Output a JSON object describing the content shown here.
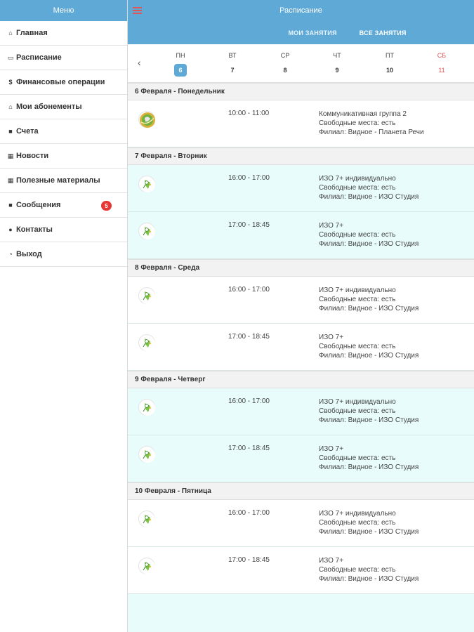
{
  "sidebar": {
    "title": "Меню",
    "items": [
      {
        "icon": "home-icon",
        "glyph": "⌂",
        "label": "Главная"
      },
      {
        "icon": "calendar-icon",
        "glyph": "▭",
        "label": "Расписание"
      },
      {
        "icon": "dollar-icon",
        "glyph": "$",
        "label": "Финансовые операции"
      },
      {
        "icon": "ticket-icon",
        "glyph": "⌂",
        "label": "Мои абонементы"
      },
      {
        "icon": "invoice-icon",
        "glyph": "■",
        "label": "Счета"
      },
      {
        "icon": "news-icon",
        "glyph": "▦",
        "label": "Новости"
      },
      {
        "icon": "materials-icon",
        "glyph": "▦",
        "label": "Полезные материалы"
      },
      {
        "icon": "messages-icon",
        "glyph": "■",
        "label": "Сообщения",
        "badge": "5"
      },
      {
        "icon": "location-icon",
        "glyph": "●",
        "label": "Контакты"
      },
      {
        "icon": "logout-icon",
        "glyph": "◔",
        "label": "Выход"
      }
    ]
  },
  "topbar": {
    "title": "Расписание"
  },
  "tabs": [
    {
      "label": "МОИ ЗАНЯТИЯ",
      "active": false
    },
    {
      "label": "ВСЕ ЗАНЯТИЯ",
      "active": true
    }
  ],
  "week": [
    {
      "name": "ПН",
      "num": "6",
      "selected": true
    },
    {
      "name": "ВТ",
      "num": "7"
    },
    {
      "name": "СР",
      "num": "8"
    },
    {
      "name": "ЧТ",
      "num": "9"
    },
    {
      "name": "ПТ",
      "num": "10"
    },
    {
      "name": "СБ",
      "num": "11",
      "weekend": true
    }
  ],
  "days": [
    {
      "header": "6 Февраля - Понедельник",
      "lessons": [
        {
          "time": "10:00 - 11:00",
          "title": "Коммуникативная группа 2",
          "places": "Свободные места: есть",
          "branch": "Филиал: Видное - Планета Речи",
          "bg": "white",
          "icon": "planet-logo-icon"
        }
      ]
    },
    {
      "header": "7 Февраля - Вторник",
      "lessons": [
        {
          "time": "16:00 - 17:00",
          "title": "ИЗО 7+ индивидуально",
          "places": "Свободные места: есть",
          "branch": "Филиал: Видное - ИЗО Студия",
          "bg": "cyan",
          "icon": "art-studio-logo-icon"
        },
        {
          "time": "17:00 - 18:45",
          "title": "ИЗО 7+",
          "places": "Свободные места: есть",
          "branch": "Филиал: Видное - ИЗО Студия",
          "bg": "cyan",
          "icon": "art-studio-logo-icon"
        }
      ]
    },
    {
      "header": "8 Февраля - Среда",
      "lessons": [
        {
          "time": "16:00 - 17:00",
          "title": "ИЗО 7+ индивидуально",
          "places": "Свободные места: есть",
          "branch": "Филиал: Видное - ИЗО Студия",
          "bg": "white",
          "icon": "art-studio-logo-icon"
        },
        {
          "time": "17:00 - 18:45",
          "title": "ИЗО 7+",
          "places": "Свободные места: есть",
          "branch": "Филиал: Видное - ИЗО Студия",
          "bg": "white",
          "icon": "art-studio-logo-icon"
        }
      ]
    },
    {
      "header": "9 Февраля - Четверг",
      "lessons": [
        {
          "time": "16:00 - 17:00",
          "title": "ИЗО 7+ индивидуально",
          "places": "Свободные места: есть",
          "branch": "Филиал: Видное - ИЗО Студия",
          "bg": "cyan",
          "icon": "art-studio-logo-icon"
        },
        {
          "time": "17:00 - 18:45",
          "title": "ИЗО 7+",
          "places": "Свободные места: есть",
          "branch": "Филиал: Видное - ИЗО Студия",
          "bg": "cyan",
          "icon": "art-studio-logo-icon"
        }
      ]
    },
    {
      "header": "10 Февраля - Пятница",
      "lessons": [
        {
          "time": "16:00 - 17:00",
          "title": "ИЗО 7+ индивидуально",
          "places": "Свободные места: есть",
          "branch": "Филиал: Видное - ИЗО Студия",
          "bg": "white",
          "icon": "art-studio-logo-icon"
        },
        {
          "time": "17:00 - 18:45",
          "title": "ИЗО 7+",
          "places": "Свободные места: есть",
          "branch": "Филиал: Видное - ИЗО Студия",
          "bg": "white",
          "icon": "art-studio-logo-icon"
        }
      ]
    }
  ],
  "colors": {
    "accent": "#5fa9d6",
    "badge": "#e53935",
    "weekend": "#e05555",
    "rowCyan": "#e8fcfc"
  }
}
